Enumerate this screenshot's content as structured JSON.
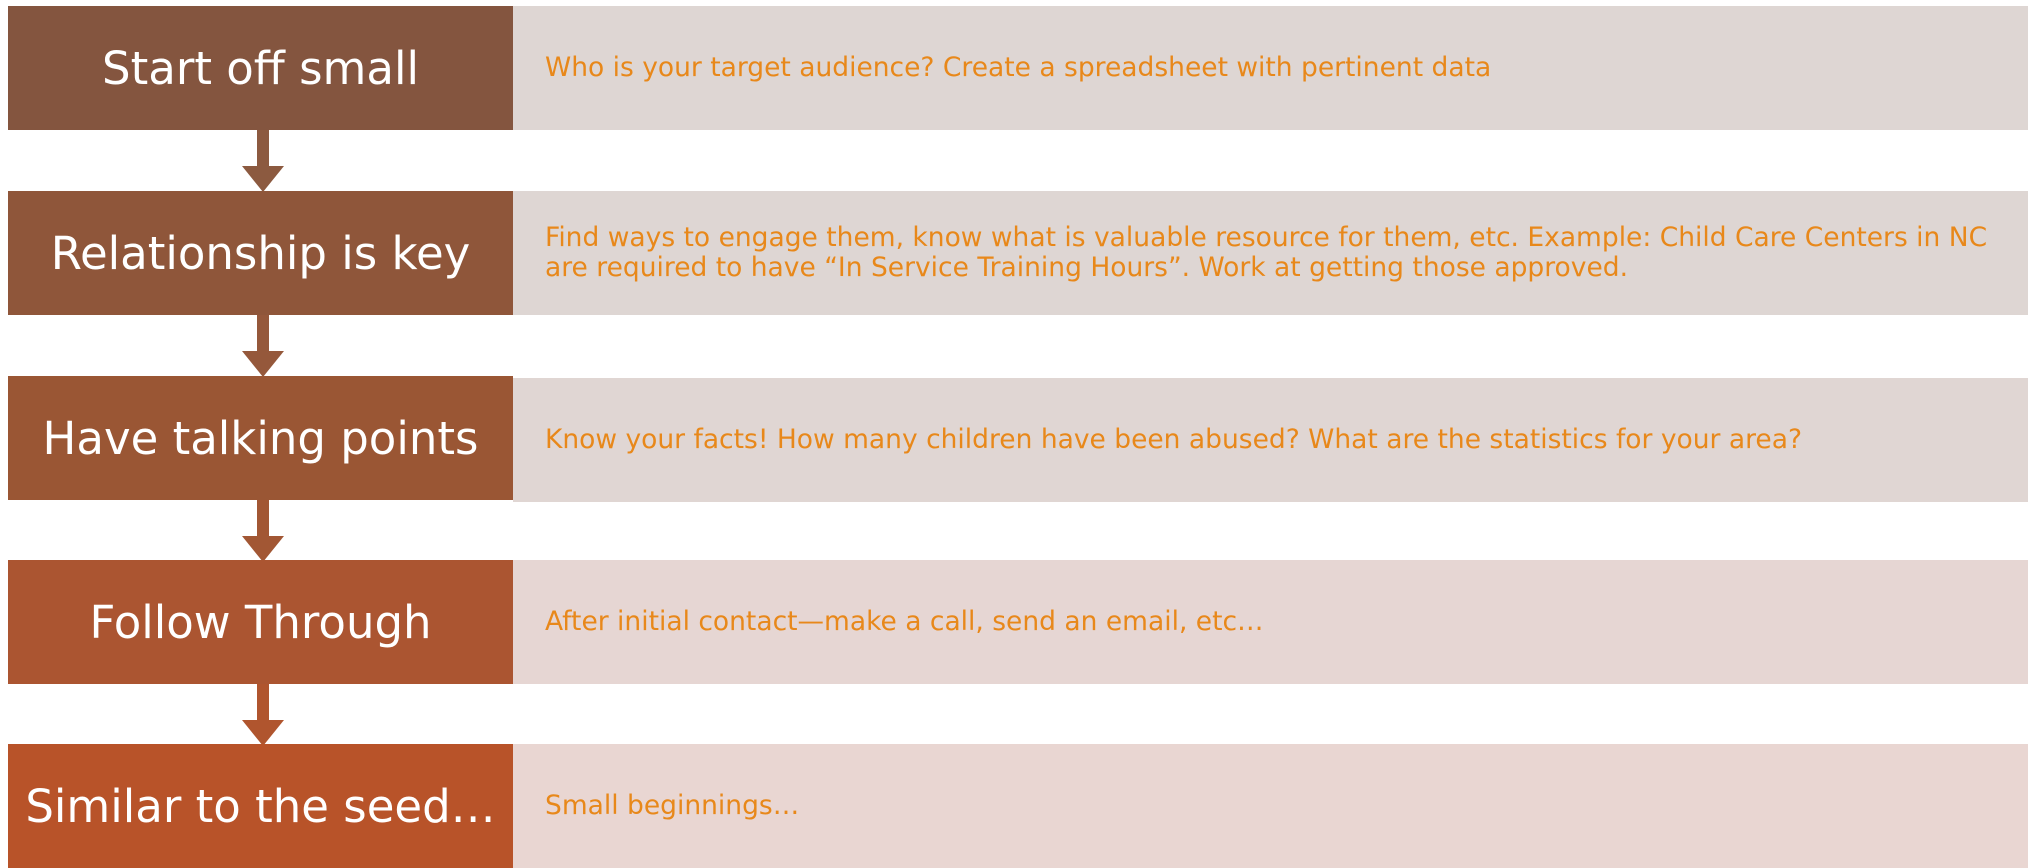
{
  "steps": [
    {
      "title": "Start off small",
      "text": "Who is your target audience? Create a spreadsheet with pertinent data"
    },
    {
      "title": "Relationship is key",
      "text": "Find ways to engage them, know what is valuable resource for them, etc. Example: Child Care Centers in NC are required to have “In Service Training Hours”. Work at getting those approved."
    },
    {
      "title": "Have talking points",
      "text": "Know your facts! How many children have been abused? What are the statistics for your area?"
    },
    {
      "title": "Follow Through",
      "text": "After initial contact—make a call, send an email, etc…"
    },
    {
      "title": "Similar to the seed…",
      "text": "Small beginnings…"
    }
  ],
  "colors": {
    "step_fills": [
      "#84553f",
      "#8f563a",
      "#9a5634",
      "#ab5531",
      "#b85329"
    ],
    "panel_fills": [
      "#ded6d3",
      "#ded6d3",
      "#e0d6d3",
      "#e6d6d3",
      "#e9d6d2"
    ],
    "description_text": "#e8881a",
    "title_text": "#ffffff"
  }
}
